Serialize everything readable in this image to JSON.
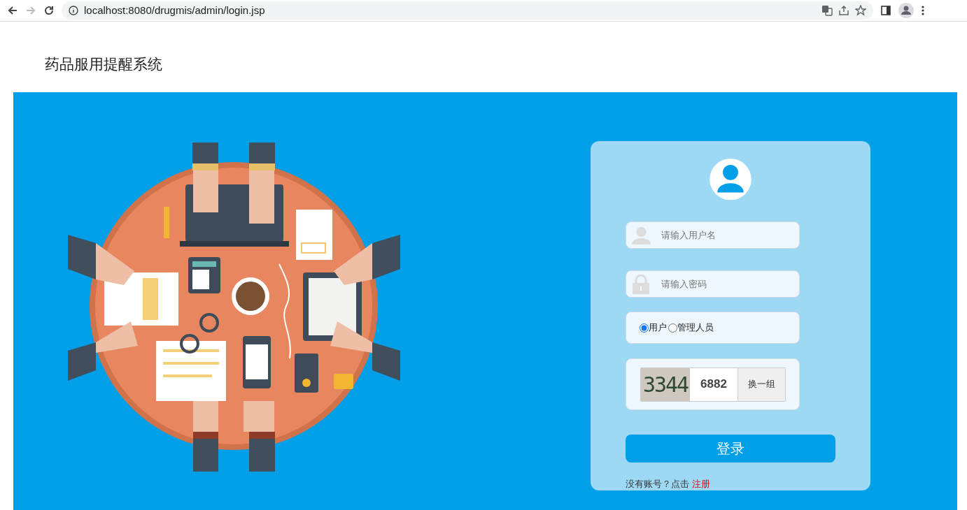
{
  "browser": {
    "url": "localhost:8080/drugmis/admin/login.jsp",
    "forward_disabled": true
  },
  "header": {
    "title": "药品服用提醒系统"
  },
  "login": {
    "username": {
      "placeholder": "请输入用户名"
    },
    "password": {
      "placeholder": "请输入密码"
    },
    "roles": [
      {
        "label": "用户",
        "selected": true
      },
      {
        "label": "管理人员",
        "selected": false
      }
    ],
    "captcha": {
      "image_text": "3344",
      "value": "6882",
      "refresh": "换一组"
    },
    "submit": "登录",
    "footer": {
      "text": "没有账号？点击",
      "link": "注册"
    }
  }
}
